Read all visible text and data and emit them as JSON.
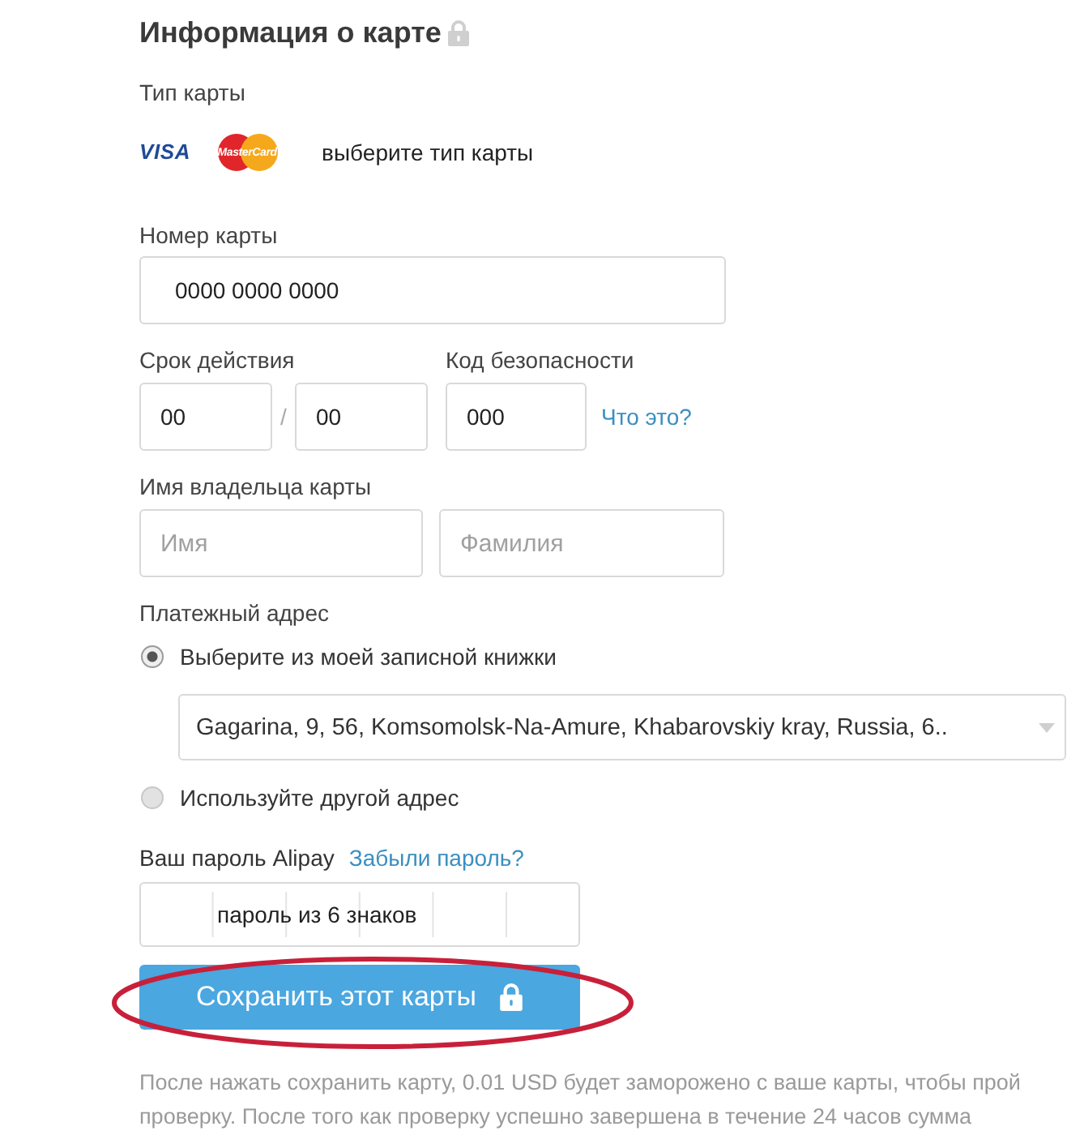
{
  "title": "Информация о карте",
  "card_type": {
    "label": "Тип карты",
    "brands": [
      {
        "kind": "visa",
        "text": "VISA"
      },
      {
        "kind": "mastercard",
        "text": "MasterCard"
      }
    ],
    "hint": "выберите тип карты"
  },
  "card_number": {
    "label": "Номер карты",
    "value": "0000 0000 0000"
  },
  "expiry": {
    "label": "Срок действия",
    "month": {
      "value": "00"
    },
    "separator": "/",
    "year": {
      "value": "00"
    }
  },
  "security_code": {
    "label": "Код безопасности",
    "value": "000",
    "help_link": "Что это?"
  },
  "cardholder": {
    "label": "Имя владельца карты",
    "first_name": {
      "placeholder": "Имя"
    },
    "last_name": {
      "placeholder": "Фамилия"
    }
  },
  "billing_address": {
    "label": "Платежный адрес",
    "options": [
      {
        "kind": "address_book",
        "label": "Выберите из моей записной книжки",
        "selected": true,
        "address": "Gagarina, 9, 56, Komsomolsk-Na-Amure, Khabarovskiy kray, Russia, 6.."
      },
      {
        "kind": "other",
        "label": "Используйте другой адрес",
        "selected": false
      }
    ]
  },
  "password": {
    "label": "Ваш пароль Alipay",
    "forgot_link": "Забыли пароль?",
    "placeholder": "пароль из 6 знаков"
  },
  "save_button": {
    "label": "Сохранить этот карты",
    "highlighted": true
  },
  "note": {
    "lines": [
      "После нажать сохранить карту, 0.01 USD будет заморожено с ваше карты, чтобы прой",
      "проверку. После того как проверку успешно завершена в течение 24 часов сумма"
    ]
  }
}
